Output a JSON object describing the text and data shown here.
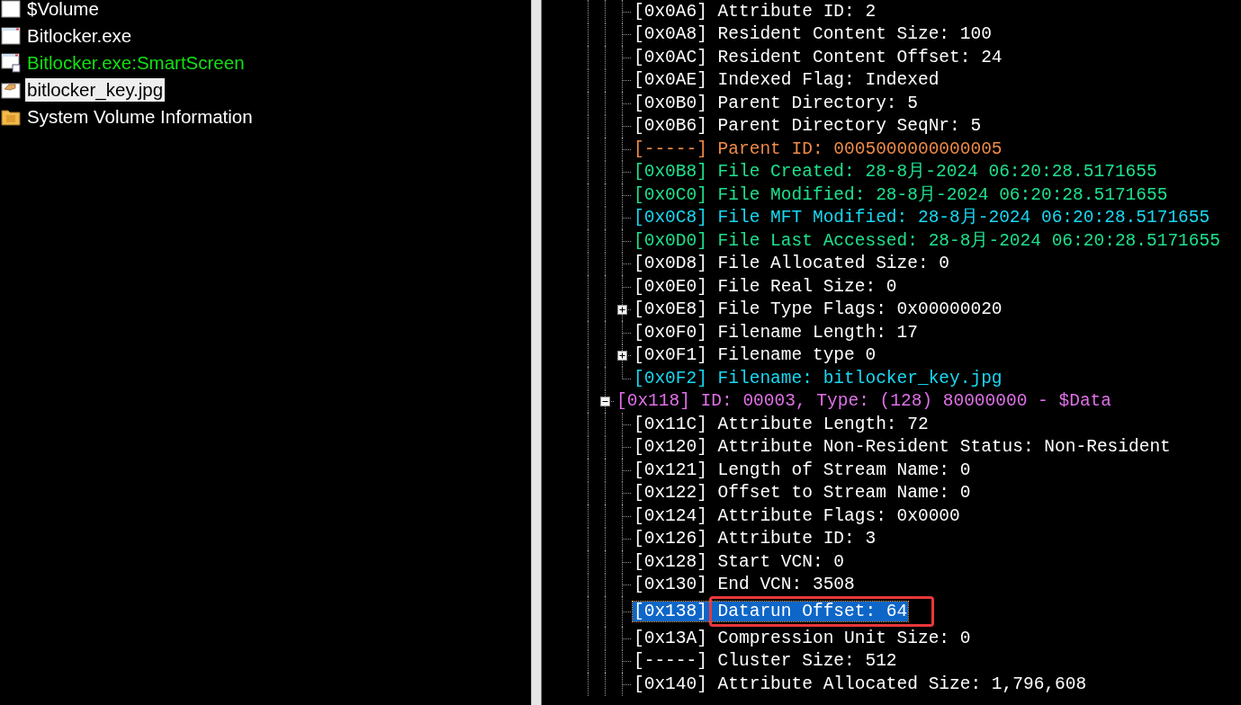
{
  "file_list": [
    {
      "name": "$Volume",
      "kind": "document",
      "color": "#ffffff",
      "selected": false
    },
    {
      "name": "Bitlocker.exe",
      "kind": "window",
      "color": "#ffffff",
      "selected": false
    },
    {
      "name": "Bitlocker.exe:SmartScreen",
      "kind": "stream",
      "color": "#12e012",
      "selected": false
    },
    {
      "name": "bitlocker_key.jpg",
      "kind": "image",
      "color": "#000000",
      "selected": true
    },
    {
      "name": "System Volume Information",
      "kind": "folder",
      "color": "#ffffff",
      "selected": false
    }
  ],
  "tree": [
    {
      "children": [
        {
          "text": "[0x0A6] Attribute ID: 2",
          "color": "#ffffff",
          "selected": false
        },
        {
          "text": "[0x0A8] Resident Content Size: 100",
          "color": "#ffffff",
          "selected": false
        },
        {
          "text": "[0x0AC] Resident Content Offset: 24",
          "color": "#ffffff",
          "selected": false
        },
        {
          "text": "[0x0AE] Indexed Flag: Indexed",
          "color": "#ffffff",
          "selected": false
        },
        {
          "text": "[0x0B0] Parent Directory: 5",
          "color": "#ffffff",
          "selected": false
        },
        {
          "text": "[0x0B6] Parent Directory SeqNr: 5",
          "color": "#ffffff",
          "selected": false
        },
        {
          "text": "[-----] Parent ID: 0005000000000005",
          "color": "#f08a48",
          "selected": false
        },
        {
          "text": "[0x0B8] File Created: 28-8月-2024 06:20:28.5171655",
          "color": "#1ee08c",
          "selected": false
        },
        {
          "text": "[0x0C0] File Modified: 28-8月-2024 06:20:28.5171655",
          "color": "#1ee08c",
          "selected": false
        },
        {
          "text": "[0x0C8] File MFT Modified: 28-8月-2024 06:20:28.5171655",
          "color": "#18d8f2",
          "selected": false
        },
        {
          "text": "[0x0D0] File Last Accessed: 28-8月-2024 06:20:28.5171655",
          "color": "#1ee08c",
          "selected": false
        },
        {
          "text": "[0x0D8] File Allocated Size: 0",
          "color": "#ffffff",
          "selected": false
        },
        {
          "text": "[0x0E0] File Real Size: 0",
          "color": "#ffffff",
          "selected": false
        },
        {
          "text": "[0x0E8] File Type Flags: 0x00000020",
          "color": "#ffffff",
          "selected": false,
          "expanded": false
        },
        {
          "text": "[0x0F0] Filename Length: 17",
          "color": "#ffffff",
          "selected": false
        },
        {
          "text": "[0x0F1] Filename type 0",
          "color": "#ffffff",
          "selected": false,
          "expanded": false
        },
        {
          "text": "[0x0F2] Filename: bitlocker_key.jpg",
          "color": "#18d8f2",
          "selected": false
        }
      ]
    },
    {
      "text": "[0x118] ID: 00003, Type: (128) 80000000 - $Data",
      "color": "#e070e8",
      "selected": false,
      "expanded": true,
      "children": [
        {
          "text": "[0x11C] Attribute Length: 72",
          "color": "#ffffff",
          "selected": false
        },
        {
          "text": "[0x120] Attribute Non-Resident Status: Non-Resident",
          "color": "#ffffff",
          "selected": false
        },
        {
          "text": "[0x121] Length of Stream Name: 0",
          "color": "#ffffff",
          "selected": false
        },
        {
          "text": "[0x122] Offset to Stream Name: 0",
          "color": "#ffffff",
          "selected": false
        },
        {
          "text": "[0x124] Attribute Flags: 0x0000",
          "color": "#ffffff",
          "selected": false
        },
        {
          "text": "[0x126] Attribute ID: 3",
          "color": "#ffffff",
          "selected": false
        },
        {
          "text": "[0x128] Start VCN: 0",
          "color": "#ffffff",
          "selected": false
        },
        {
          "text": "[0x130] End VCN: 3508",
          "color": "#ffffff",
          "selected": false
        },
        {
          "text": "[0x138] Datarun Offset: 64",
          "selected": true,
          "annotated": true
        },
        {
          "text": "[0x13A] Compression Unit Size: 0",
          "color": "#ffffff",
          "selected": false
        },
        {
          "text": "[-----] Cluster Size: 512",
          "color": "#ffffff",
          "selected": false
        },
        {
          "text": "[0x140] Attribute Allocated Size: 1,796,608",
          "color": "#ffffff",
          "selected": false
        }
      ]
    }
  ]
}
